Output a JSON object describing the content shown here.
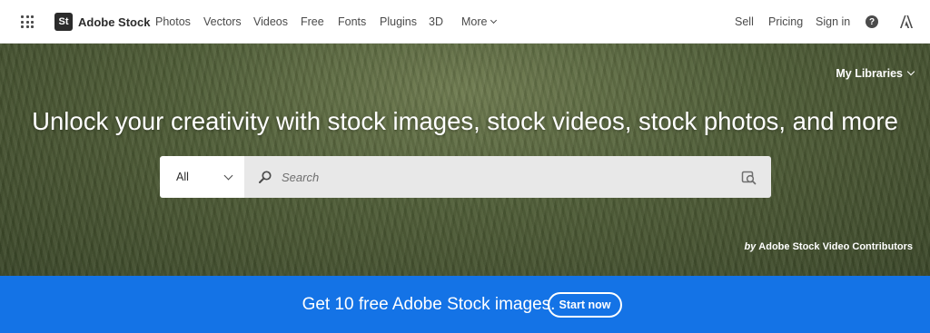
{
  "header": {
    "brand_badge": "St",
    "brand_name": "Adobe Stock",
    "nav": [
      "Photos",
      "Vectors",
      "Videos",
      "Free",
      "Fonts",
      "Plugins",
      "3D",
      "More"
    ],
    "right_links": [
      "Sell",
      "Pricing",
      "Sign in"
    ],
    "help_glyph": "?"
  },
  "hero": {
    "my_libraries": "My Libraries",
    "headline": "Unlock your creativity with stock images, stock videos, stock photos, and more",
    "search": {
      "type_value": "All",
      "placeholder": "Search"
    },
    "credit_prefix": "by",
    "credit_name": "Adobe Stock Video Contributors"
  },
  "promo": {
    "text": "Get 10 free Adobe Stock images.",
    "button": "Start now"
  },
  "colors": {
    "accent": "#1473e6",
    "nav_text": "#4b4b4b",
    "search_bg": "#e8e8e8"
  },
  "icons": {
    "apps": "app-grid-icon",
    "help": "help-icon",
    "adobe": "adobe-logo-icon",
    "search": "search-icon",
    "visual_search": "visual-search-icon"
  }
}
